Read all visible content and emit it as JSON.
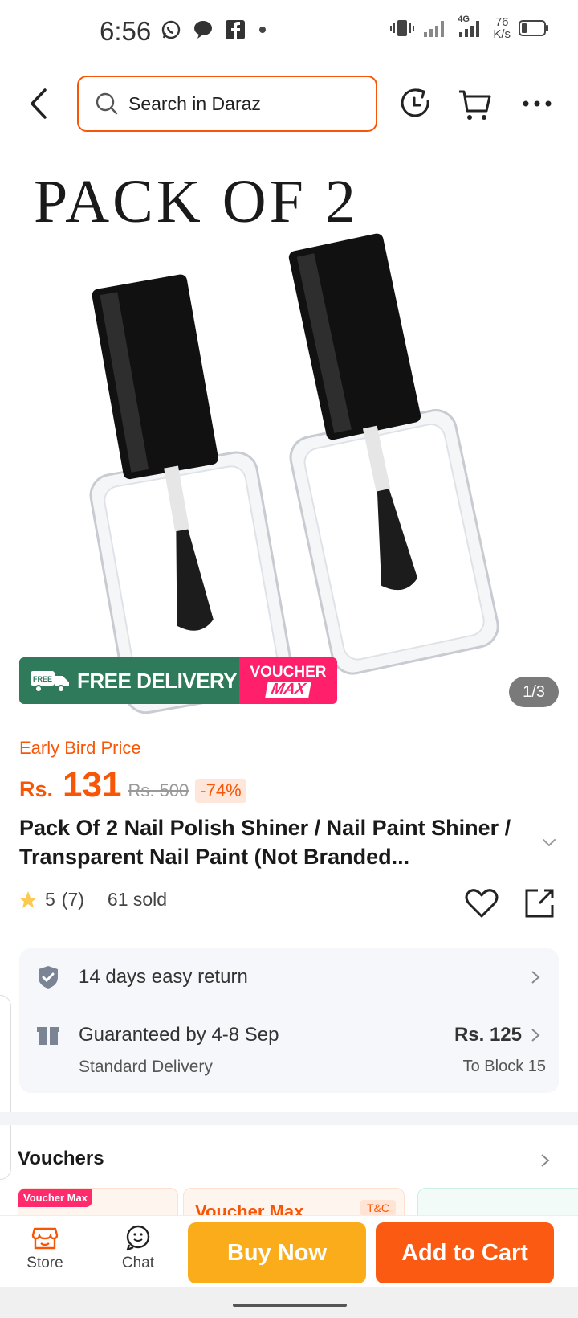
{
  "status_bar": {
    "time": "6:56",
    "network": "4G",
    "speed_value": "76",
    "speed_unit": "K/s",
    "icons": [
      "whatsapp-icon",
      "chat-bubble-icon",
      "facebook-icon",
      "dot-icon",
      "vibrate-icon",
      "signal-icon",
      "battery-icon"
    ]
  },
  "header": {
    "search_placeholder": "Search in Daraz",
    "icons": [
      "back-icon",
      "search-icon",
      "history-icon",
      "cart-icon",
      "more-icon"
    ],
    "accent": "#f85606"
  },
  "product_image": {
    "title_text": "PACK OF 2",
    "counter": "1/3",
    "banner_free": "FREE DELIVERY",
    "banner_free_badge": "FREE",
    "banner_voucher_top": "VOUCHER",
    "banner_voucher_bottom": "MAX"
  },
  "pricing": {
    "label": "Early Bird Price",
    "currency": "Rs.",
    "price": "131",
    "old_price": "Rs. 500",
    "discount": "-74%"
  },
  "product": {
    "title": "Pack Of 2 Nail Polish Shiner / Nail Paint Shiner / Transparent Nail Paint (Not Branded...",
    "rating": "5",
    "rating_count": "(7)",
    "sold": "61 sold"
  },
  "delivery": {
    "return_text": "14 days easy return",
    "guarantee_text": "Guaranteed by 4-8 Sep",
    "delivery_type": "Standard Delivery",
    "delivery_price": "Rs. 125",
    "location": "To Block 15"
  },
  "vouchers": {
    "title": "Vouchers",
    "tag": "Voucher Max",
    "card_title": "Voucher Max",
    "tc": "T&C"
  },
  "bottom_bar": {
    "store": "Store",
    "chat": "Chat",
    "buy_now": "Buy Now",
    "add_to_cart": "Add to Cart"
  },
  "colors": {
    "orange": "#f85606",
    "buy_now": "#fbac1b",
    "add_to_cart": "#fa5a12",
    "free_delivery": "#2f7a5b",
    "voucher_pink": "#ff1f6b"
  }
}
